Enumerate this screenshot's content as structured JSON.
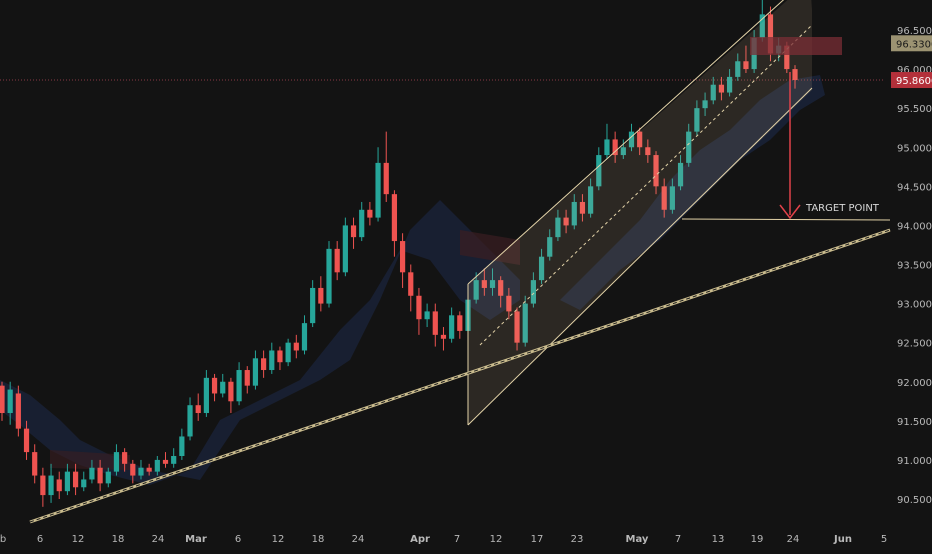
{
  "chart_data": {
    "type": "candlestick",
    "y_axis": {
      "ticks": [
        "96.5000",
        "96.0000",
        "95.5000",
        "95.0000",
        "94.5000",
        "94.0000",
        "93.5000",
        "93.0000",
        "92.5000",
        "92.0000",
        "91.5000",
        "91.0000",
        "90.5000"
      ],
      "range": [
        90.25,
        96.95
      ]
    },
    "x_axis": {
      "ticks": [
        "eb",
        "6",
        "12",
        "18",
        "24",
        "Mar",
        "6",
        "12",
        "18",
        "24",
        "Apr",
        "7",
        "12",
        "17",
        "23",
        "May",
        "7",
        "13",
        "19",
        "24",
        "Jun",
        "5"
      ],
      "bold_ticks": [
        "Mar",
        "Apr",
        "May",
        "Jun"
      ]
    },
    "price_labels": [
      {
        "value": "96.3300",
        "price": 96.33,
        "role": "upper-box"
      },
      {
        "value": "95.8600",
        "price": 95.86,
        "role": "last-price"
      }
    ],
    "annotations": [
      {
        "text": "TARGET POINT",
        "price": 94.08
      }
    ],
    "candles": [
      [
        91.95,
        91.6,
        92.0,
        91.5
      ],
      [
        91.6,
        91.9,
        92.0,
        91.45
      ],
      [
        91.85,
        91.4,
        91.95,
        91.3
      ],
      [
        91.4,
        91.1,
        91.5,
        91.0
      ],
      [
        91.1,
        90.8,
        91.2,
        90.7
      ],
      [
        90.8,
        90.55,
        90.9,
        90.4
      ],
      [
        90.55,
        90.8,
        90.95,
        90.45
      ],
      [
        90.75,
        90.6,
        90.85,
        90.5
      ],
      [
        90.6,
        90.85,
        90.95,
        90.55
      ],
      [
        90.85,
        90.65,
        90.95,
        90.55
      ],
      [
        90.65,
        90.75,
        90.85,
        90.6
      ],
      [
        90.75,
        90.9,
        91.0,
        90.7
      ],
      [
        90.9,
        90.7,
        91.0,
        90.6
      ],
      [
        90.7,
        90.85,
        90.9,
        90.65
      ],
      [
        90.85,
        91.1,
        91.2,
        90.8
      ],
      [
        91.1,
        90.95,
        91.15,
        90.85
      ],
      [
        90.95,
        90.8,
        91.0,
        90.7
      ],
      [
        90.8,
        90.9,
        91.0,
        90.75
      ],
      [
        90.9,
        90.85,
        90.95,
        90.8
      ],
      [
        90.85,
        91.0,
        91.05,
        90.8
      ],
      [
        91.0,
        90.95,
        91.1,
        90.9
      ],
      [
        90.95,
        91.05,
        91.15,
        90.9
      ],
      [
        91.05,
        91.3,
        91.4,
        91.0
      ],
      [
        91.3,
        91.7,
        91.8,
        91.25
      ],
      [
        91.7,
        91.6,
        91.85,
        91.5
      ],
      [
        91.6,
        92.05,
        92.15,
        91.55
      ],
      [
        92.05,
        91.85,
        92.1,
        91.75
      ],
      [
        91.85,
        92.0,
        92.1,
        91.8
      ],
      [
        92.0,
        91.75,
        92.05,
        91.6
      ],
      [
        91.75,
        92.15,
        92.25,
        91.7
      ],
      [
        92.15,
        91.95,
        92.2,
        91.85
      ],
      [
        91.95,
        92.3,
        92.4,
        91.9
      ],
      [
        92.3,
        92.15,
        92.4,
        92.05
      ],
      [
        92.15,
        92.4,
        92.5,
        92.1
      ],
      [
        92.4,
        92.25,
        92.45,
        92.15
      ],
      [
        92.25,
        92.5,
        92.55,
        92.2
      ],
      [
        92.5,
        92.4,
        92.6,
        92.3
      ],
      [
        92.4,
        92.75,
        92.85,
        92.35
      ],
      [
        92.75,
        93.2,
        93.3,
        92.7
      ],
      [
        93.2,
        93.0,
        93.35,
        92.9
      ],
      [
        93.0,
        93.7,
        93.8,
        92.95
      ],
      [
        93.7,
        93.4,
        93.8,
        93.3
      ],
      [
        93.4,
        94.0,
        94.1,
        93.35
      ],
      [
        94.0,
        93.85,
        94.1,
        93.7
      ],
      [
        93.85,
        94.2,
        94.3,
        93.8
      ],
      [
        94.2,
        94.1,
        94.3,
        94.0
      ],
      [
        94.1,
        94.8,
        95.0,
        94.05
      ],
      [
        94.8,
        94.4,
        95.2,
        94.3
      ],
      [
        94.4,
        93.8,
        94.45,
        93.6
      ],
      [
        93.8,
        93.4,
        93.9,
        93.2
      ],
      [
        93.4,
        93.1,
        93.5,
        92.9
      ],
      [
        93.1,
        92.8,
        93.2,
        92.6
      ],
      [
        92.8,
        92.9,
        93.0,
        92.7
      ],
      [
        92.9,
        92.6,
        93.0,
        92.45
      ],
      [
        92.6,
        92.55,
        92.7,
        92.4
      ],
      [
        92.55,
        92.85,
        92.95,
        92.5
      ],
      [
        92.85,
        92.65,
        92.9,
        92.55
      ],
      [
        92.65,
        93.05,
        93.15,
        92.6
      ],
      [
        93.05,
        93.3,
        93.4,
        93.0
      ],
      [
        93.3,
        93.2,
        93.45,
        93.1
      ],
      [
        93.2,
        93.3,
        93.45,
        93.1
      ],
      [
        93.3,
        93.1,
        93.35,
        92.95
      ],
      [
        93.1,
        92.9,
        93.2,
        92.8
      ],
      [
        92.9,
        92.5,
        92.95,
        92.4
      ],
      [
        92.5,
        93.0,
        93.1,
        92.45
      ],
      [
        93.0,
        93.3,
        93.4,
        92.95
      ],
      [
        93.3,
        93.6,
        93.7,
        93.25
      ],
      [
        93.6,
        93.85,
        93.95,
        93.55
      ],
      [
        93.85,
        94.1,
        94.2,
        93.8
      ],
      [
        94.1,
        94.0,
        94.2,
        93.9
      ],
      [
        94.0,
        94.3,
        94.4,
        93.95
      ],
      [
        94.3,
        94.15,
        94.4,
        94.05
      ],
      [
        94.15,
        94.5,
        94.6,
        94.1
      ],
      [
        94.5,
        94.9,
        95.0,
        94.45
      ],
      [
        94.9,
        95.1,
        95.3,
        94.85
      ],
      [
        95.1,
        94.9,
        95.2,
        94.8
      ],
      [
        94.9,
        95.0,
        95.1,
        94.85
      ],
      [
        95.0,
        95.2,
        95.3,
        94.95
      ],
      [
        95.2,
        95.0,
        95.25,
        94.9
      ],
      [
        95.0,
        94.9,
        95.1,
        94.8
      ],
      [
        94.9,
        94.5,
        94.95,
        94.4
      ],
      [
        94.5,
        94.2,
        94.6,
        94.1
      ],
      [
        94.2,
        94.5,
        94.6,
        94.15
      ],
      [
        94.5,
        94.8,
        94.9,
        94.45
      ],
      [
        94.8,
        95.2,
        95.3,
        94.75
      ],
      [
        95.2,
        95.5,
        95.6,
        95.15
      ],
      [
        95.5,
        95.6,
        95.7,
        95.4
      ],
      [
        95.6,
        95.8,
        95.9,
        95.55
      ],
      [
        95.8,
        95.7,
        95.9,
        95.6
      ],
      [
        95.7,
        95.9,
        96.0,
        95.65
      ],
      [
        95.9,
        96.1,
        96.2,
        95.85
      ],
      [
        96.1,
        96.0,
        96.3,
        95.95
      ],
      [
        96.0,
        96.4,
        96.5,
        95.95
      ],
      [
        96.4,
        96.7,
        96.9,
        96.35
      ],
      [
        96.7,
        96.2,
        96.8,
        96.1
      ],
      [
        96.2,
        96.3,
        96.4,
        96.1
      ],
      [
        96.3,
        96.0,
        96.35,
        95.95
      ],
      [
        96.0,
        95.86,
        96.05,
        95.75
      ]
    ]
  }
}
